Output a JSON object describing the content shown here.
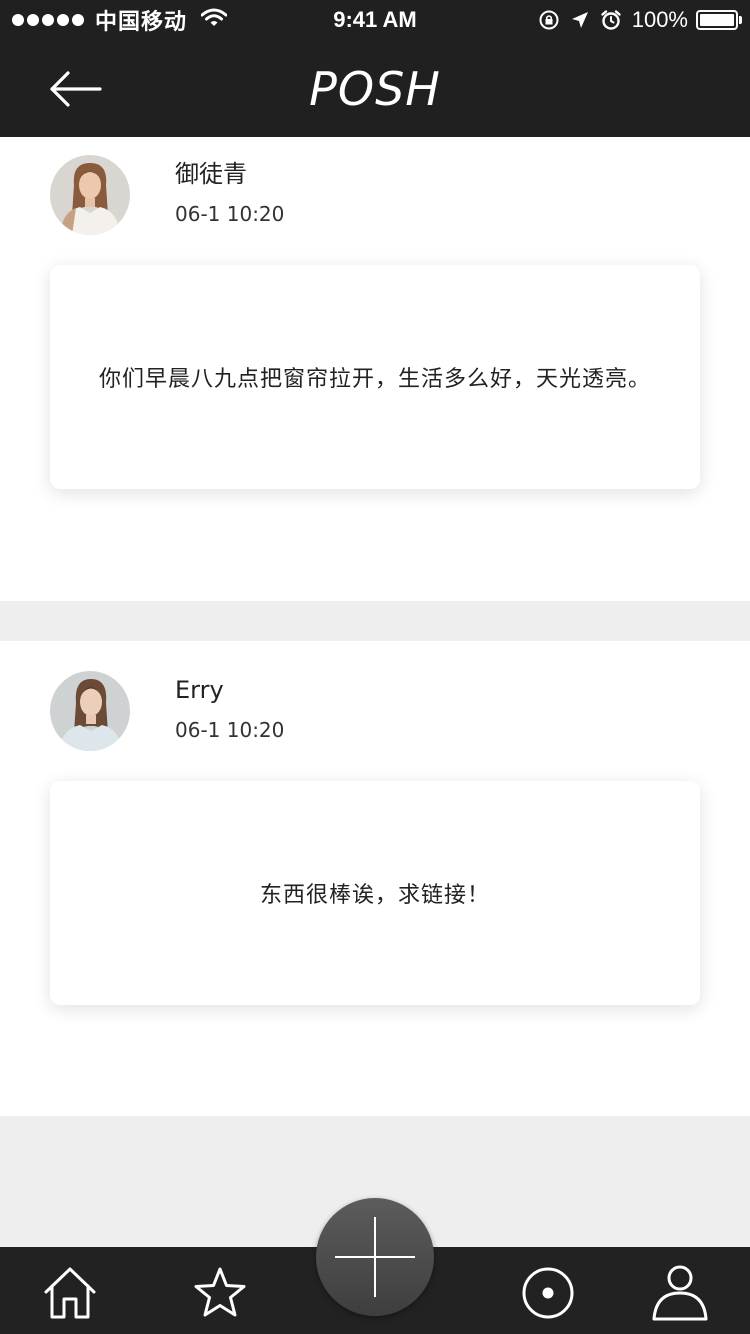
{
  "status_bar": {
    "carrier": "中国移动",
    "time": "9:41 AM",
    "battery": "100%"
  },
  "nav": {
    "title": "POSH",
    "back_icon": "arrow-left-icon"
  },
  "comments": [
    {
      "username": "御徒青",
      "time": "06-1 10:20",
      "text": "你们早晨八九点把窗帘拉开，生活多么好，天光透亮。"
    },
    {
      "username": "Erry",
      "time": "06-1 10:20",
      "text": "东西很棒诶，求链接！"
    }
  ],
  "tab_bar": {
    "items": [
      "home-icon",
      "star-icon",
      "add-icon",
      "target-icon",
      "profile-icon"
    ]
  },
  "colors": {
    "bar_background": "#202020",
    "page_background": "#eeeeee",
    "card_background": "#ffffff",
    "fab_gradient_top": "#5c5c5c",
    "fab_gradient_bottom": "#3e3e3e"
  }
}
